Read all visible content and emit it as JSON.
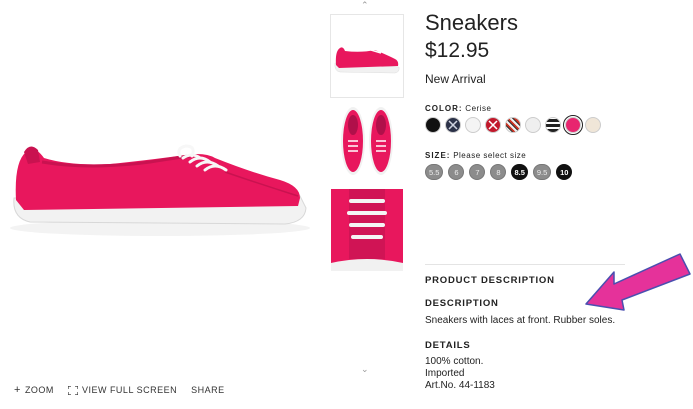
{
  "product": {
    "title": "Sneakers",
    "price": "$12.95",
    "badge": "New Arrival"
  },
  "color": {
    "label": "COLOR:",
    "selected": "Cerise",
    "swatches": [
      {
        "name": "black",
        "color": "#111111"
      },
      {
        "name": "navy-pattern",
        "color": "#2b3148"
      },
      {
        "name": "white",
        "color": "#f4f4f4"
      },
      {
        "name": "red-pattern",
        "color": "#c2182b"
      },
      {
        "name": "print-pattern",
        "color": "#d9c7a8"
      },
      {
        "name": "light-grey",
        "color": "#efefef"
      },
      {
        "name": "black-white-stripe",
        "color": "#222222"
      },
      {
        "name": "cerise",
        "color": "#e8256f"
      },
      {
        "name": "floral",
        "color": "#f0e6d8"
      }
    ]
  },
  "size": {
    "label": "SIZE:",
    "prompt": "Please select size",
    "options": [
      {
        "label": "5.5",
        "available": false
      },
      {
        "label": "6",
        "available": false
      },
      {
        "label": "7",
        "available": false
      },
      {
        "label": "8",
        "available": false
      },
      {
        "label": "8.5",
        "available": true
      },
      {
        "label": "9.5",
        "available": false
      },
      {
        "label": "10",
        "available": true
      }
    ]
  },
  "sections": {
    "product_description": "PRODUCT DESCRIPTION",
    "description_heading": "DESCRIPTION",
    "description_text": "Sneakers with laces at front. Rubber soles.",
    "details_heading": "DETAILS",
    "details": [
      "100% cotton.",
      "Imported",
      "Art.No. 44-1183"
    ]
  },
  "toolbar": {
    "zoom": "ZOOM",
    "full_screen": "VIEW FULL SCREEN",
    "share": "SHARE"
  },
  "icons": {
    "thumb_up": "chevron-up-icon",
    "thumb_down": "chevron-down-icon",
    "zoom": "plus-icon",
    "full_screen": "expand-icon"
  },
  "colors": {
    "shoe": "#e8175d",
    "sole": "#f2f2f2",
    "arrow": "#e5329a"
  }
}
